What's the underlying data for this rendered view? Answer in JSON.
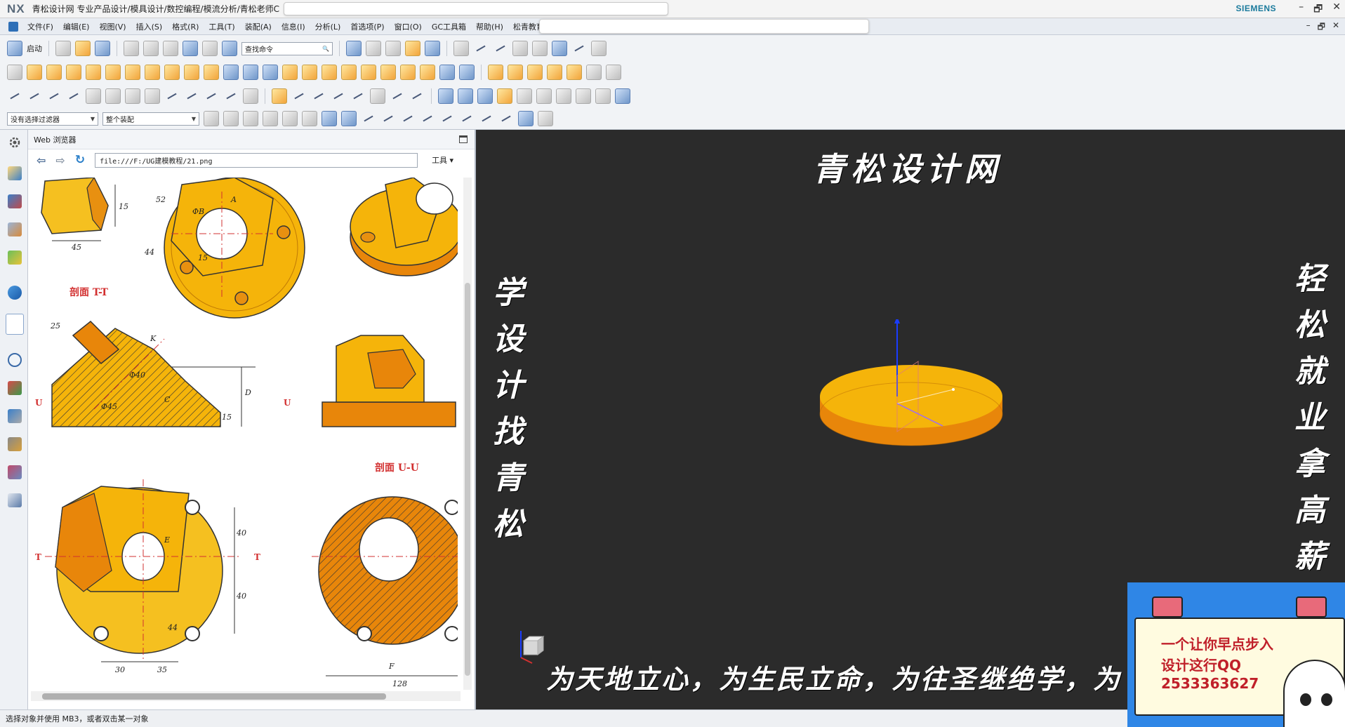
{
  "titlebar": {
    "logo": "NX",
    "title": "青松设计网 专业产品设计/模具设计/数控编程/模流分析/青松老师C",
    "brand": "SIEMENS",
    "minimize": "–",
    "restore": "🗗",
    "close": "✕"
  },
  "menubar": {
    "items": [
      "文件(F)",
      "编辑(E)",
      "视图(V)",
      "插入(S)",
      "格式(R)",
      "工具(T)",
      "装配(A)",
      "信息(I)",
      "分析(L)",
      "首选项(P)",
      "窗口(O)",
      "GC工具箱",
      "帮助(H)",
      "松青教育"
    ],
    "minimize": "–",
    "restore": "🗗",
    "close": "✕"
  },
  "toolbar": {
    "start_label": "启动",
    "command_search": "查找命令",
    "selection_filter": "没有选择过滤器",
    "assembly_scope": "整个装配"
  },
  "webpanel": {
    "title": "Web 浏览器",
    "url": "file:///F:/UG建模教程/21.png",
    "tools_label": "工具"
  },
  "drawing": {
    "section_tt": "剖面 T-T",
    "section_uu": "剖面 U-U",
    "dims": [
      "45",
      "15",
      "52",
      "A",
      "ΦB",
      "44",
      "15",
      "25",
      "K",
      "C",
      "Φ40",
      "Φ45",
      "D",
      "15",
      "E",
      "40",
      "40",
      "44",
      "30",
      "35",
      "F",
      "128"
    ],
    "markers": [
      "U",
      "U",
      "T",
      "T"
    ]
  },
  "viewport": {
    "top_caption": "青松设计网",
    "left_caption": "学设计找青松",
    "right_caption": "轻松就业拿高薪",
    "bottom_caption": "为天地立心，为生民立命，为往圣继绝学，为"
  },
  "promo": {
    "line1": "一个让你早点步入",
    "line2": "设计这行QQ",
    "line3": "2533363627"
  },
  "statusbar": {
    "text": "选择对象并使用 MB3，或者双击某一对象"
  },
  "colors": {
    "part_yellow": "#f5b40a",
    "part_orange": "#e8860a",
    "viewport_bg": "#2b2b2b",
    "axis_blue": "#1a3cff",
    "section_red": "#d23030"
  }
}
